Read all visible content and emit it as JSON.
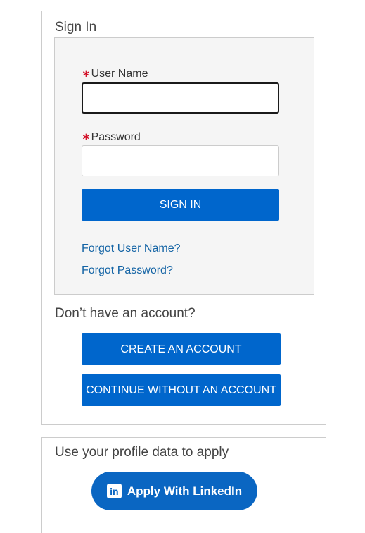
{
  "signin": {
    "title": "Sign In",
    "username": {
      "required_mark": "∗",
      "label": "User Name",
      "value": "",
      "placeholder": ""
    },
    "password": {
      "required_mark": "∗",
      "label": "Password",
      "value": "",
      "placeholder": ""
    },
    "submit_label": "SIGN IN",
    "forgot_username": "Forgot User Name?",
    "forgot_password": "Forgot Password?"
  },
  "account": {
    "prompt": "Don’t have an account?",
    "create_label": "CREATE AN ACCOUNT",
    "continue_label": "CONTINUE WITHOUT AN ACCOUNT"
  },
  "apply": {
    "title": "Use your profile data to apply",
    "linkedin_icon": "linkedin-icon",
    "linkedin_icon_glyph": "in",
    "linkedin_label": "Apply With LinkedIn"
  },
  "colors": {
    "primary_button": "#0066cc",
    "link": "#1464a5",
    "required": "#d0021b",
    "linkedin": "#0a66c2"
  }
}
